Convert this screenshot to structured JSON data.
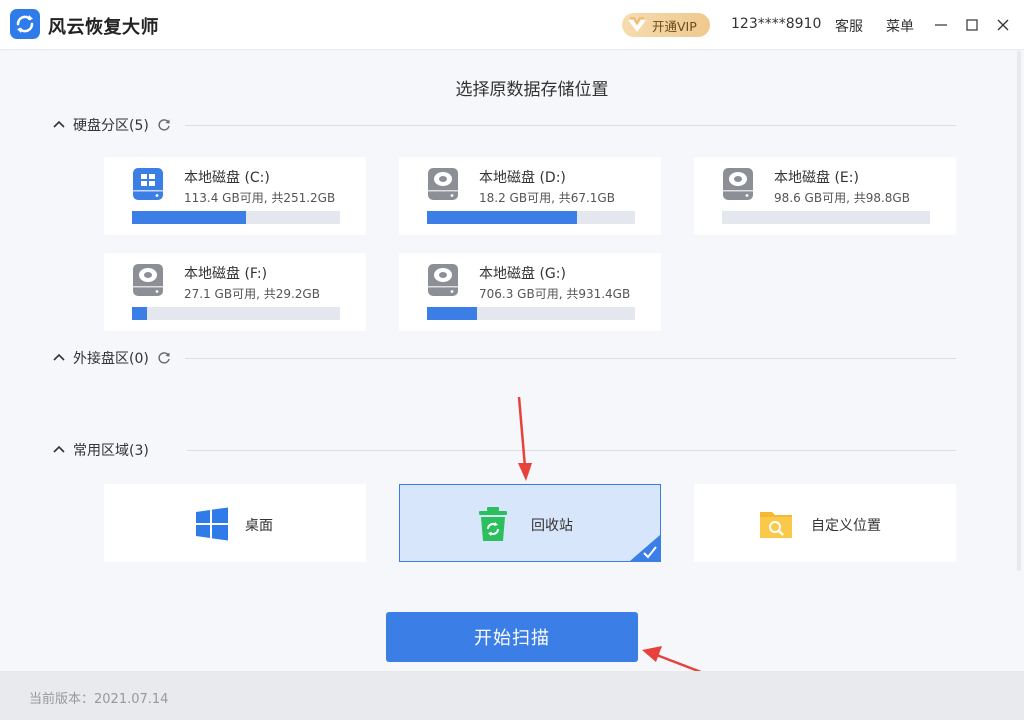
{
  "app": {
    "title": "风云恢复大师",
    "vip_label": "开通VIP",
    "user_phone": "123****8910",
    "service_label": "客服",
    "menu_label": "菜单"
  },
  "page_heading": "选择原数据存储位置",
  "sections": {
    "partitions": {
      "label": "硬盘分区(5)"
    },
    "external": {
      "label": "外接盘区(0)"
    },
    "common": {
      "label": "常用区域(3)"
    }
  },
  "disks": [
    {
      "name": "本地磁盘 (C:)",
      "space": "113.4 GB可用, 共251.2GB",
      "used_fraction": 0.55,
      "system": true
    },
    {
      "name": "本地磁盘 (D:)",
      "space": "18.2 GB可用, 共67.1GB",
      "used_fraction": 0.72,
      "system": false
    },
    {
      "name": "本地磁盘 (E:)",
      "space": "98.6 GB可用, 共98.8GB",
      "used_fraction": 0.0,
      "system": false
    },
    {
      "name": "本地磁盘 (F:)",
      "space": "27.1 GB可用, 共29.2GB",
      "used_fraction": 0.07,
      "system": false
    },
    {
      "name": "本地磁盘 (G:)",
      "space": "706.3 GB可用, 共931.4GB",
      "used_fraction": 0.24,
      "system": false
    }
  ],
  "common_areas": [
    {
      "label": "桌面",
      "icon": "windows-icon",
      "selected": false
    },
    {
      "label": "回收站",
      "icon": "recycle-bin-icon",
      "selected": true
    },
    {
      "label": "自定义位置",
      "icon": "folder-search-icon",
      "selected": false
    }
  ],
  "scan_button": "开始扫描",
  "footer": {
    "version": "当前版本：2021.07.14"
  },
  "colors": {
    "accent": "#3b7fe6",
    "selected_bg": "#d8e6fb",
    "arrow": "#e8413c",
    "recycle_green": "#2bbf5d",
    "folder_yellow": "#f5b82e"
  }
}
